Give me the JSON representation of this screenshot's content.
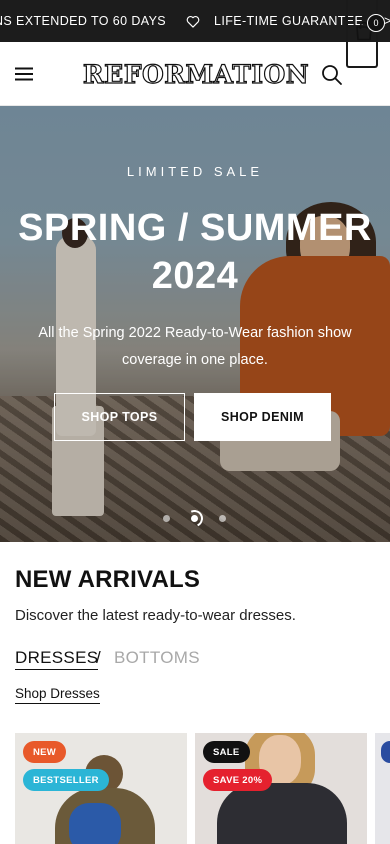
{
  "announcement": {
    "messages": [
      "NS EXTENDED TO 60 DAYS",
      "LIFE-TIME GUARANTEE",
      ">"
    ]
  },
  "header": {
    "logo": "REFORMATION",
    "cart_count": "0",
    "icons": [
      "menu-icon",
      "search-icon",
      "cart-icon"
    ]
  },
  "hero": {
    "eyebrow": "LIMITED SALE",
    "title_line1": "SPRING / SUMMER",
    "title_line2": "2024",
    "subtitle": "All the Spring 2022 Ready-to-Wear fashion show coverage in one place.",
    "primary_button": "SHOP TOPS",
    "secondary_button": "SHOP DENIM",
    "slides": 3,
    "active_slide": 2
  },
  "new_arrivals": {
    "title": "NEW ARRIVALS",
    "subtitle": "Discover the latest ready-to-wear dresses.",
    "tabs": [
      "DRESSES",
      "BOTTOMS"
    ],
    "tab_separator": "/",
    "active_tab": "DRESSES",
    "shop_link": "Shop Dresses"
  },
  "products": [
    {
      "badges": [
        "NEW",
        "BESTSELLER"
      ]
    },
    {
      "badges": [
        "SALE",
        "SAVE 20%"
      ]
    },
    {
      "badges": []
    }
  ],
  "colors": {
    "announcement_bg": "#1c1c1c",
    "badge_new": "#e8592a",
    "badge_bestseller": "#2bb5d6",
    "badge_sale": "#111111",
    "badge_save": "#e5212e",
    "tab_inactive": "#a8a8a8"
  }
}
